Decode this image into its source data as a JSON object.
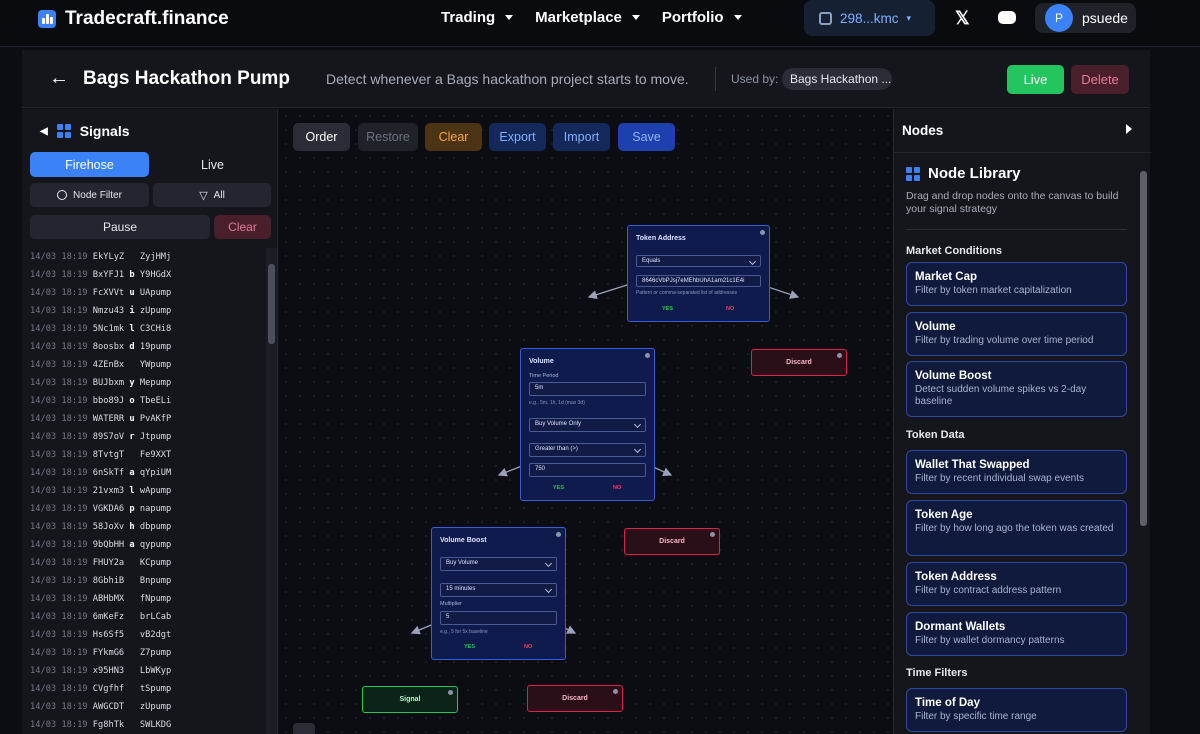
{
  "brand": {
    "name": "Tradecraft.finance"
  },
  "nav": [
    {
      "label": "Trading"
    },
    {
      "label": "Marketplace"
    },
    {
      "label": "Portfolio"
    }
  ],
  "wallet": {
    "address": "298...kmc"
  },
  "social": {
    "x": "𝕏"
  },
  "user": {
    "initial": "P",
    "name": "psuede"
  },
  "strategy": {
    "back": "←",
    "title": "Bags Hackathon Pump",
    "description": "Detect whenever a Bags hackathon project starts to move.",
    "used_by_label": "Used by:",
    "used_by_value": "Bags Hackathon ...",
    "live_label": "Live",
    "delete_label": "Delete"
  },
  "signals": {
    "title": "Signals",
    "tabs": [
      "Firehose",
      "Live"
    ],
    "node_filter": "Node Filter",
    "all": "All",
    "pause": "Pause",
    "clear": "Clear",
    "feed": [
      {
        "ts": "14/03 18:19",
        "a": "EkYLyZ",
        "m": " ",
        "b": "ZyjHMj"
      },
      {
        "ts": "14/03 18:19",
        "a": "BxYFJ1",
        "m": "b",
        "b": "Y9HGdX"
      },
      {
        "ts": "14/03 18:19",
        "a": "FcXVVt",
        "m": "u",
        "b": "UApump"
      },
      {
        "ts": "14/03 18:19",
        "a": "Nmzu43",
        "m": "i",
        "b": "zUpump"
      },
      {
        "ts": "14/03 18:19",
        "a": "5Nc1mk",
        "m": "l",
        "b": "C3CHi8"
      },
      {
        "ts": "14/03 18:19",
        "a": "8oosbx",
        "m": "d",
        "b": "19pump"
      },
      {
        "ts": "14/03 18:19",
        "a": "4ZEnBx",
        "m": " ",
        "b": "YWpump"
      },
      {
        "ts": "14/03 18:19",
        "a": "BUJbxm",
        "m": "y",
        "b": "Mepump"
      },
      {
        "ts": "14/03 18:19",
        "a": "bbo89J",
        "m": "o",
        "b": "TbeELi"
      },
      {
        "ts": "14/03 18:19",
        "a": "WATERR",
        "m": "u",
        "b": "PvAKfP"
      },
      {
        "ts": "14/03 18:19",
        "a": "89S7oV",
        "m": "r",
        "b": "Jtpump"
      },
      {
        "ts": "14/03 18:19",
        "a": "8TvtgT",
        "m": " ",
        "b": "Fe9XXT"
      },
      {
        "ts": "14/03 18:19",
        "a": "6nSkTf",
        "m": "a",
        "b": "qYpiUM"
      },
      {
        "ts": "14/03 18:19",
        "a": "21vxm3",
        "m": "l",
        "b": "wApump"
      },
      {
        "ts": "14/03 18:19",
        "a": "VGKDA6",
        "m": "p",
        "b": "napump"
      },
      {
        "ts": "14/03 18:19",
        "a": "58JoXv",
        "m": "h",
        "b": "dbpump"
      },
      {
        "ts": "14/03 18:19",
        "a": "9bQbHH",
        "m": "a",
        "b": "qypump"
      },
      {
        "ts": "14/03 18:19",
        "a": "FHUY2a",
        "m": " ",
        "b": "KCpump"
      },
      {
        "ts": "14/03 18:19",
        "a": "8GbhiB",
        "m": " ",
        "b": "Bnpump"
      },
      {
        "ts": "14/03 18:19",
        "a": "ABHbMX",
        "m": " ",
        "b": "fNpump"
      },
      {
        "ts": "14/03 18:19",
        "a": "6mKeFz",
        "m": " ",
        "b": "brLCab"
      },
      {
        "ts": "14/03 18:19",
        "a": "Hs6Sf5",
        "m": " ",
        "b": "vB2dgt"
      },
      {
        "ts": "14/03 18:19",
        "a": "FYkmG6",
        "m": " ",
        "b": "Z7pump"
      },
      {
        "ts": "14/03 18:19",
        "a": "x95HN3",
        "m": " ",
        "b": "LbWKyp"
      },
      {
        "ts": "14/03 18:19",
        "a": "CVgfhf",
        "m": " ",
        "b": "tSpump"
      },
      {
        "ts": "14/03 18:19",
        "a": "AWGCDT",
        "m": " ",
        "b": "zUpump"
      },
      {
        "ts": "14/03 18:19",
        "a": "Fg8hTk",
        "m": " ",
        "b": "SWLKDG"
      }
    ]
  },
  "toolbar": {
    "order": "Order",
    "restore": "Restore",
    "clear": "Clear",
    "export": "Export",
    "import": "Import",
    "save": "Save"
  },
  "flow": {
    "token_address": {
      "title": "Token Address",
      "operator": "Equals",
      "value": "8646cVbPJsj7eMEhbUhA1am21c1E4i",
      "hint": "Pattern or comma-separated list of addresses",
      "yes": "YES",
      "no": "NO"
    },
    "volume": {
      "title": "Volume",
      "period_label": "Time Period",
      "period": "5m",
      "period_hint": "e.g., 5m, 1h, 1d (max 3d)",
      "side": "Buy Volume Only",
      "comparator": "Greater than (>)",
      "threshold": "750",
      "yes": "YES",
      "no": "NO"
    },
    "volume_boost": {
      "title": "Volume Boost",
      "type": "Buy Volume",
      "window": "15 minutes",
      "multiplier_label": "Multiplier",
      "multiplier": "5",
      "multiplier_hint": "e.g., 5 for 5x baseline",
      "yes": "YES",
      "no": "NO"
    },
    "discard_label": "Discard",
    "signal_label": "Signal"
  },
  "nodes_panel": {
    "title": "Nodes",
    "library_title": "Node Library",
    "library_desc": "Drag and drop nodes onto the canvas to build your signal strategy",
    "categories": [
      {
        "name": "Market Conditions",
        "items": [
          {
            "title": "Market Cap",
            "desc": "Filter by token market capitalization"
          },
          {
            "title": "Volume",
            "desc": "Filter by trading volume over time period"
          },
          {
            "title": "Volume Boost",
            "desc": "Detect sudden volume spikes vs 2-day baseline"
          }
        ]
      },
      {
        "name": "Token Data",
        "items": [
          {
            "title": "Wallet That Swapped",
            "desc": "Filter by recent individual swap events"
          },
          {
            "title": "Token Age",
            "desc": "Filter by how long ago the token was created"
          },
          {
            "title": "Token Address",
            "desc": "Filter by contract address pattern"
          },
          {
            "title": "Dormant Wallets",
            "desc": "Filter by wallet dormancy patterns"
          }
        ]
      },
      {
        "name": "Time Filters",
        "items": [
          {
            "title": "Time of Day",
            "desc": "Filter by specific time range"
          }
        ]
      }
    ]
  },
  "colors": {
    "accent": "#3b82f6",
    "live": "#22c55e",
    "danger": "#e11d48",
    "node_bg": "#0f1a4d"
  }
}
